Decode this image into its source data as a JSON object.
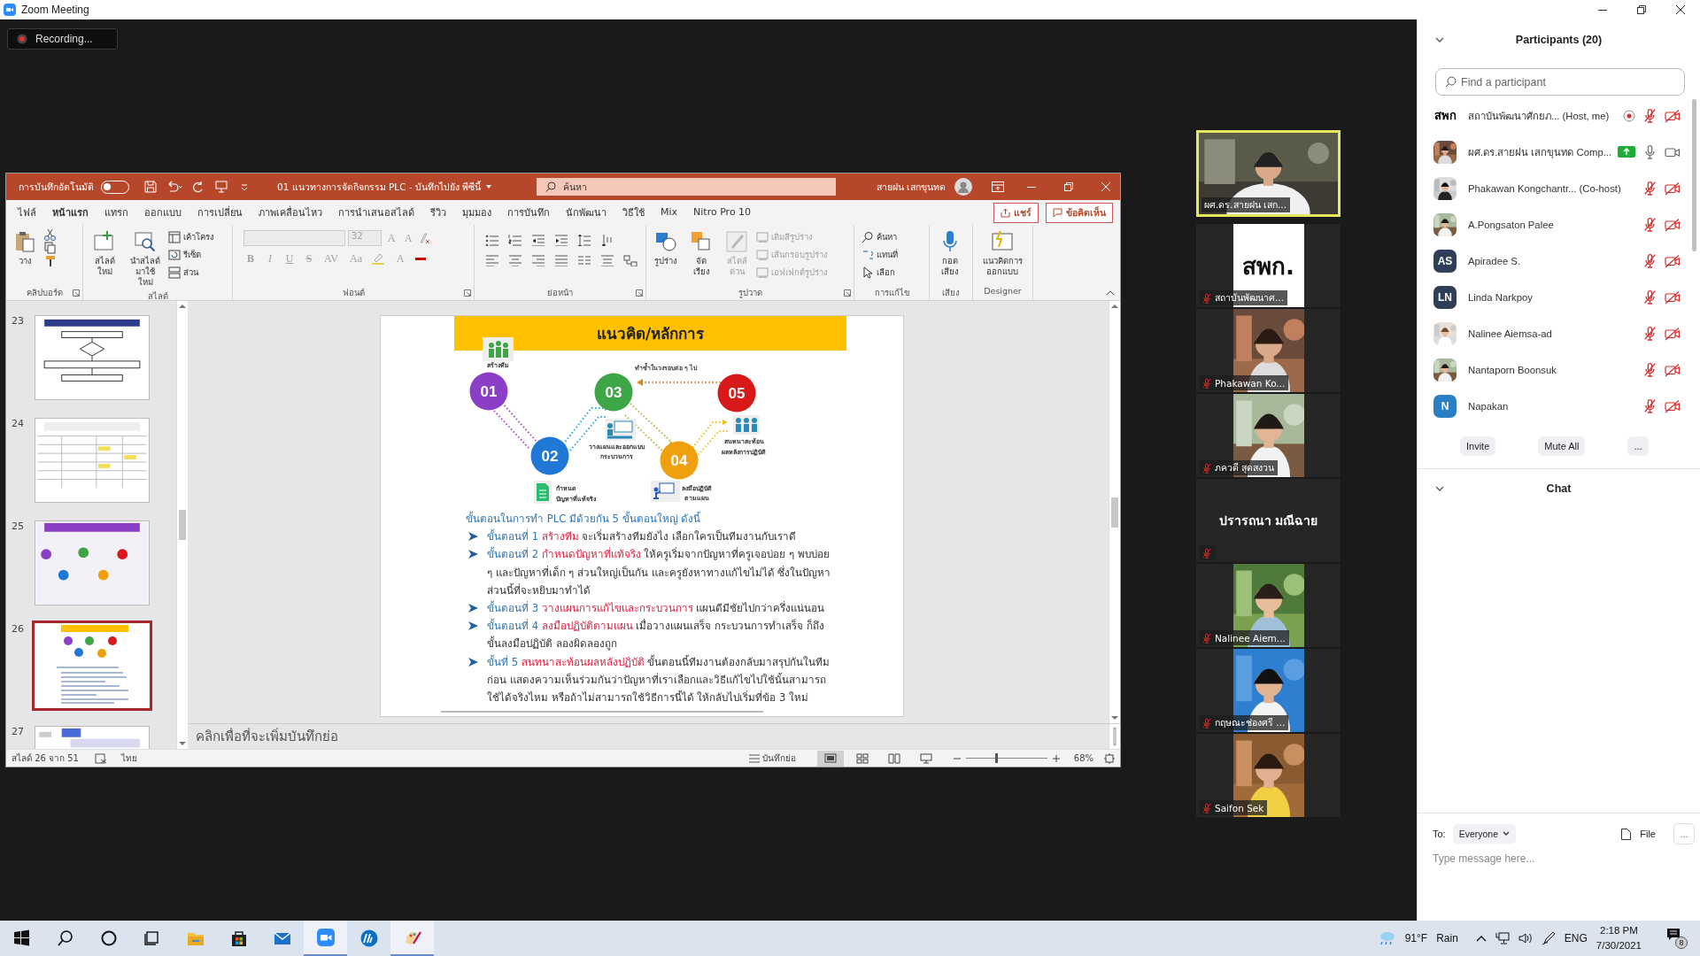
{
  "window": {
    "title": "Zoom Meeting"
  },
  "recording": {
    "label": "Recording..."
  },
  "powerpoint": {
    "autosave": {
      "label": "การบันทึกอัตโนมัติ",
      "on": false
    },
    "document_title": "01 แนวทางการจัดกิจกรรม PLC - บันทึกไปยัง พีซีนี้",
    "search": {
      "placeholder": "ค้นหา"
    },
    "user_name": "สายฝน เสกขุนทด",
    "tabs": [
      {
        "label": "ไฟล์",
        "selected": false
      },
      {
        "label": "หน้าแรก",
        "selected": true
      },
      {
        "label": "แทรก",
        "selected": false
      },
      {
        "label": "ออกแบบ",
        "selected": false
      },
      {
        "label": "การเปลี่ยน",
        "selected": false
      },
      {
        "label": "ภาพเคลื่อนไหว",
        "selected": false
      },
      {
        "label": "การนำเสนอสไลด์",
        "selected": false
      },
      {
        "label": "รีวิว",
        "selected": false
      },
      {
        "label": "มุมมอง",
        "selected": false
      },
      {
        "label": "การบันทึก",
        "selected": false
      },
      {
        "label": "นักพัฒนา",
        "selected": false
      },
      {
        "label": "วิธีใช้",
        "selected": false
      },
      {
        "label": "Mix",
        "selected": false
      },
      {
        "label": "Nitro Pro 10",
        "selected": false
      }
    ],
    "share_button": "แชร์",
    "comments_button": "ข้อคิดเห็น",
    "ribbon_groups": [
      {
        "kind": "clipboard",
        "label": "คลิปบอร์ด",
        "buttons": [
          "วาง"
        ]
      },
      {
        "kind": "slides",
        "label": "สไลด์",
        "buttons": [
          "สไลด์ใหม่",
          "นำสไลด์มาใช้ใหม่",
          "เค้าโครง",
          "รีเซ็ต",
          "ส่วน"
        ]
      },
      {
        "kind": "font",
        "label": "ฟอนต์",
        "disabled": true,
        "font_size": "32",
        "buttons": [
          "A",
          "A",
          "B",
          "I",
          "U",
          "S",
          "AV",
          "Aa",
          "A"
        ]
      },
      {
        "kind": "paragraph",
        "label": "ย่อหน้า"
      },
      {
        "kind": "drawing",
        "label": "รูปวาด",
        "buttons": [
          {
            "label": "รูปร่าง",
            "disabled": false
          },
          {
            "label": "จัดเรียง",
            "disabled": false
          },
          {
            "label": "สไตล์ด่วน",
            "disabled": true
          },
          {
            "label": "เติมสีรูปร่าง",
            "disabled": true
          },
          {
            "label": "เส้นกรอบรูปร่าง",
            "disabled": true
          },
          {
            "label": "เอฟเฟกต์รูปร่าง",
            "disabled": true
          }
        ]
      },
      {
        "kind": "editing",
        "label": "การแก้ไข",
        "buttons": [
          "ค้นหา",
          "แทนที่",
          "เลือก"
        ]
      },
      {
        "kind": "voice",
        "label": "เสียง",
        "buttons": [
          "กอด เสียง"
        ]
      },
      {
        "kind": "designer",
        "label": "Designer",
        "buttons": [
          "แนวคิดการออกแบบ"
        ]
      }
    ],
    "thumbnails": [
      {
        "number": "23",
        "kind": "flowchart",
        "selected": false
      },
      {
        "number": "24",
        "kind": "table",
        "selected": false
      },
      {
        "number": "25",
        "kind": "circles",
        "selected": false
      },
      {
        "number": "26",
        "kind": "circles-text",
        "selected": true
      },
      {
        "number": "27",
        "kind": "title",
        "selected": false
      }
    ],
    "slide": {
      "title": "แนวคิด/หลักการ",
      "loop_caption": "ทำซ้ำในวงรอบต่อ ๆ ไป",
      "steps": [
        {
          "number": "01",
          "color": "#8a3fc6",
          "caption": [
            "สร้างทีม"
          ]
        },
        {
          "number": "02",
          "color": "#1f78d6",
          "caption": [
            "กำหนด",
            "ปัญหาที่แท้จริง"
          ]
        },
        {
          "number": "03",
          "color": "#3fa648",
          "caption": [
            "วางแผนและออกแบบ",
            "กระบวนการ"
          ]
        },
        {
          "number": "04",
          "color": "#f0a00c",
          "caption": [
            "ลงมือปฏิบัติ",
            "ตามแผน"
          ]
        },
        {
          "number": "05",
          "color": "#d81919",
          "caption": [
            "สนทนาสะท้อน",
            "ผลหลังการปฏิบัติ"
          ]
        }
      ],
      "intro": "ขั้นตอนในการทำ PLC มีด้วยกัน 5 ขั้นตอนใหญ่ ดังนี้",
      "bullets": [
        {
          "lead": "ขั้นตอนที่ 1",
          "highlight": "สร้างทีม",
          "text": "จะเริ่มสร้างทีมยังไง เลือกใครเป็นทีมงานกับเราดี"
        },
        {
          "lead": "ขั้นตอนที่ 2",
          "highlight": "กำหนดปัญหาที่แท้จริง",
          "text": "ให้ครูเริ่มจากปัญหาที่ครูเจอบ่อย ๆ พบบ่อย ๆ และปัญหาที่เด็ก ๆ ส่วนใหญ่เป็นกัน และครูยังหาทางแก้ไขไม่ได้ ซึ่งในปัญหาส่วนนี้ที่จะหยิบมาทำได้"
        },
        {
          "lead": "ขั้นตอนที่ 3",
          "highlight": "วางแผนการแก้ไขและกระบวนการ",
          "text": "แผนดีมีชัยไปกว่าครึ่งแน่นอน"
        },
        {
          "lead": "ขั้นตอนที่ 4",
          "highlight": "ลงมือปฏิบัติตามแผน",
          "text": "เมื่อวางแผนเสร็จ กระบวนการทำเสร็จ ก็ถึงขั้นลงมือปฏิบัติ ลองผิดลองถูก"
        },
        {
          "lead": "ขั้นที่ 5",
          "highlight": "สนทนาสะท้อนผลหลังปฏิบัติ",
          "text": "ขั้นตอนนี้ทีมงานต้องกลับมาสรุปกันในทีมก่อน แสดงความเห็นร่วมกันว่าปัญหาที่เราเลือกและวิธีแก้ไขไปใช้นั้นสามารถใช้ได้จริงไหม หรือถ้าไม่สามารถใช้วิธีการนี้ได้ ให้กลับไปเริ่มที่ข้อ 3 ใหม่"
        }
      ]
    },
    "notes": {
      "placeholder": "คลิกเพื่อที่จะเพิ่มบันทึกย่อ"
    },
    "status_bar": {
      "slide_position": "สไลด์ 26 จาก 51",
      "language": "ไทย",
      "notes_button": "บันทึกย่อ",
      "views": [
        {
          "kind": "normal",
          "selected": true
        },
        {
          "kind": "sorter",
          "selected": false
        },
        {
          "kind": "reading",
          "selected": false
        },
        {
          "kind": "slideshow",
          "selected": false
        }
      ],
      "zoom": {
        "level": 0.36,
        "reading": "68%"
      }
    }
  },
  "video_tiles": [
    {
      "kind": "video",
      "name": "ผศ.ดร.สายฝน เสก...",
      "muted": false,
      "speaking": true
    },
    {
      "kind": "logo",
      "name": "สถาบันพัฒนาศ...",
      "logo": "สพก.",
      "muted": true,
      "speaking": false
    },
    {
      "kind": "video",
      "name": "Phakawan Ko...",
      "muted": true,
      "speaking": false
    },
    {
      "kind": "video",
      "name": "ภควดี สุดสงวน",
      "muted": true,
      "speaking": false
    },
    {
      "kind": "name",
      "name": "ปรารถนา มณีฉาย",
      "muted": true,
      "speaking": false
    },
    {
      "kind": "video",
      "name": "Nalinee Aiem...",
      "muted": true,
      "speaking": false
    },
    {
      "kind": "video",
      "name": "กฤษณะช่องศรี ...",
      "muted": true,
      "speaking": false
    },
    {
      "kind": "video",
      "name": "Saifon Sek",
      "muted": true,
      "speaking": false
    }
  ],
  "participants": {
    "title": "Participants (20)",
    "search": {
      "placeholder": "Find a participant"
    },
    "items": [
      {
        "name": "สถาบันพัฒนาศักยภ... (Host, me)",
        "kind": "text",
        "avatar_text": "สพก",
        "recording": true,
        "sharing": false,
        "muted": true,
        "video_on": false
      },
      {
        "name": "ผศ.ดร.สายฝน เสกขุนทด Comp...",
        "recording": false,
        "sharing": true,
        "muted": false,
        "video_on": true
      },
      {
        "name": "Phakawan Kongchantr... (Co-host)",
        "recording": false,
        "sharing": false,
        "muted": true,
        "video_on": false
      },
      {
        "name": "A.Pongsaton Palee",
        "recording": false,
        "sharing": false,
        "muted": true,
        "video_on": false
      },
      {
        "name": "Apiradee S.",
        "kind": "initials",
        "avatar_text": "AS",
        "color": "#2f3f57",
        "recording": false,
        "sharing": false,
        "muted": true,
        "video_on": false
      },
      {
        "name": "Linda Narkpoy",
        "kind": "initials",
        "avatar_text": "LN",
        "color": "#2f3f57",
        "recording": false,
        "sharing": false,
        "muted": true,
        "video_on": false
      },
      {
        "name": "Nalinee Aiemsa-ad",
        "recording": false,
        "sharing": false,
        "muted": true,
        "video_on": false
      },
      {
        "name": "Nantaporn Boonsuk",
        "recording": false,
        "sharing": false,
        "muted": true,
        "video_on": false
      },
      {
        "name": "Napakan",
        "kind": "initials",
        "avatar_text": "N",
        "color": "#2b80c5",
        "recording": false,
        "sharing": false,
        "muted": true,
        "video_on": false
      }
    ],
    "buttons": [
      "Invite",
      "Mute All",
      "..."
    ]
  },
  "chat": {
    "title": "Chat",
    "to_label": "To:",
    "recipient": "Everyone",
    "file_button": "File",
    "more_button": "...",
    "placeholder": "Type message here..."
  },
  "taskbar": {
    "apps": [
      {
        "kind": "start",
        "running": false
      },
      {
        "kind": "search",
        "running": false
      },
      {
        "kind": "cortana",
        "running": false
      },
      {
        "kind": "taskview",
        "running": false
      },
      {
        "kind": "explorer",
        "running": false
      },
      {
        "kind": "store",
        "running": false
      },
      {
        "kind": "mail",
        "running": false
      },
      {
        "kind": "zoom",
        "running": true
      },
      {
        "kind": "hp",
        "running": false
      },
      {
        "kind": "paint",
        "running": true
      }
    ],
    "temperature": "91°F",
    "weather": "Rain",
    "language": "ENG",
    "time": "2:18 PM",
    "date": "7/30/2021",
    "notifications": "8"
  }
}
